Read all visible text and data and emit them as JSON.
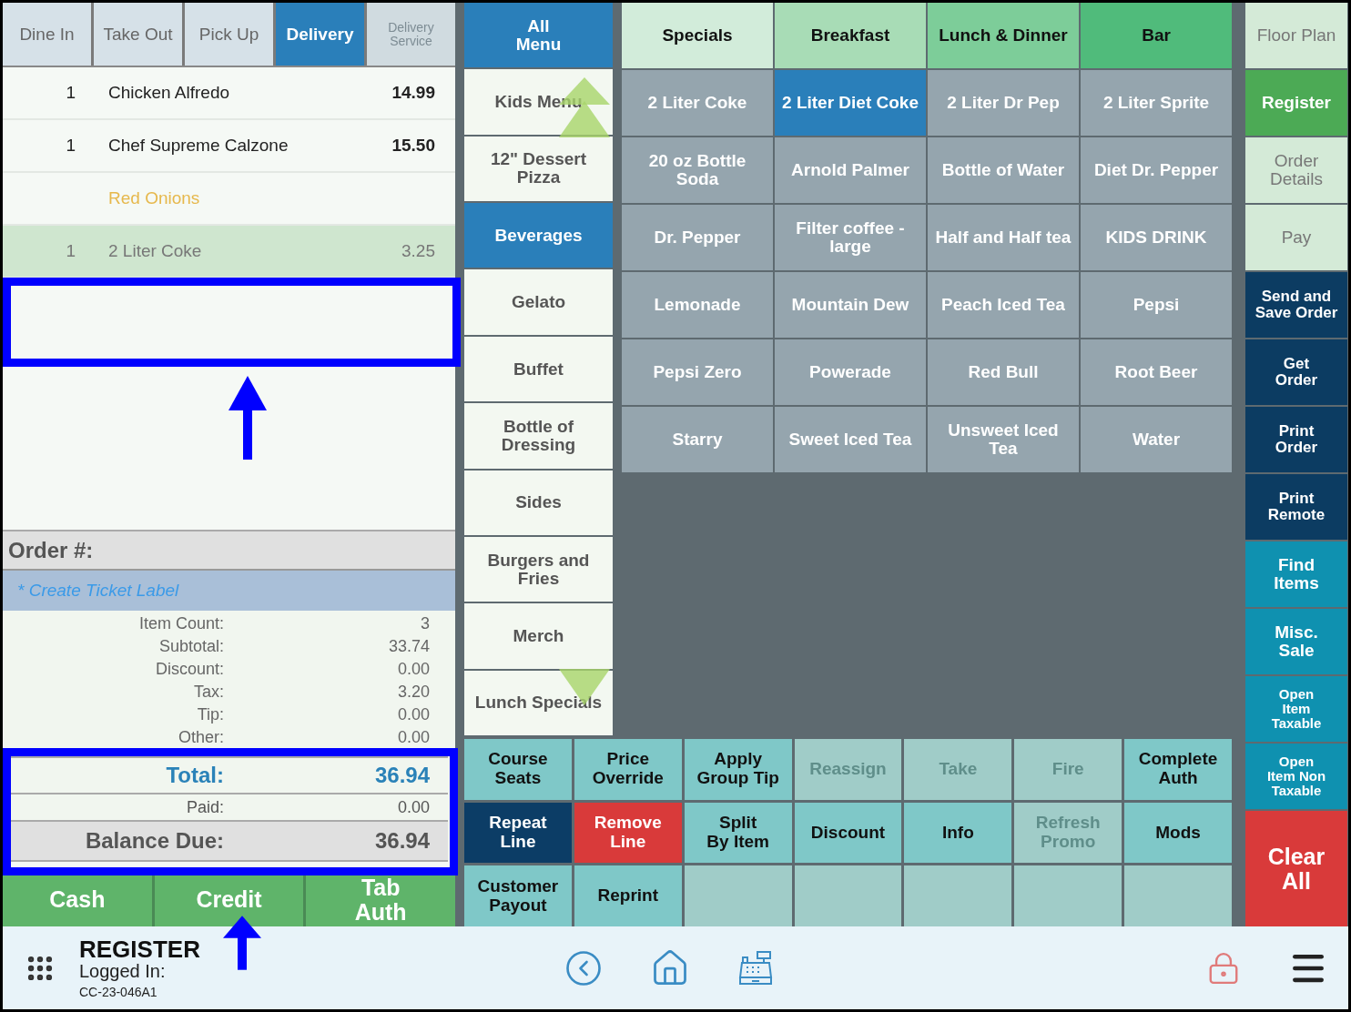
{
  "order_tabs": [
    {
      "label": "Dine In",
      "selected": false,
      "disabled": false
    },
    {
      "label": "Take Out",
      "selected": false,
      "disabled": false
    },
    {
      "label": "Pick Up",
      "selected": false,
      "disabled": false
    },
    {
      "label": "Delivery",
      "selected": true,
      "disabled": false
    },
    {
      "label": "Delivery\nService",
      "selected": false,
      "disabled": true
    }
  ],
  "order_lines": [
    {
      "kind": "item",
      "qty": "1",
      "name": "Chicken Alfredo",
      "price": "14.99",
      "selected": false
    },
    {
      "kind": "item",
      "qty": "1",
      "name": "Chef Supreme Calzone",
      "price": "15.50",
      "selected": false
    },
    {
      "kind": "modifier",
      "name": "Red Onions",
      "selected": false
    },
    {
      "kind": "item",
      "qty": "1",
      "name": "2 Liter Coke",
      "price": "3.25",
      "selected": true
    }
  ],
  "order_number": "Order #:",
  "ticket_label": "* Create Ticket Label",
  "summary": [
    {
      "label": "Item Count:",
      "value": "3"
    },
    {
      "label": "Subtotal:",
      "value": "33.74"
    },
    {
      "label": "Discount:",
      "value": "0.00"
    },
    {
      "label": "Tax:",
      "value": "3.20"
    },
    {
      "label": "Tip:",
      "value": "0.00"
    },
    {
      "label": "Other:",
      "value": "0.00"
    }
  ],
  "totals": [
    {
      "kind": "total",
      "label": "Total:",
      "value": "36.94"
    },
    {
      "kind": "paid",
      "label": "Paid:",
      "value": "0.00"
    },
    {
      "kind": "balance",
      "label": "Balance Due:",
      "value": "36.94"
    }
  ],
  "payment_buttons": [
    "Cash",
    "Credit",
    "Tab\nAuth"
  ],
  "categories": [
    {
      "label": "All\nMenu",
      "selected": true
    },
    {
      "label": "Kids Menu",
      "selected": false
    },
    {
      "label": "12\" Dessert\nPizza",
      "selected": false
    },
    {
      "label": "Beverages",
      "selected": true
    },
    {
      "label": "Gelato",
      "selected": false
    },
    {
      "label": "Buffet",
      "selected": false
    },
    {
      "label": "Bottle of\nDressing",
      "selected": false
    },
    {
      "label": "Sides",
      "selected": false
    },
    {
      "label": "Burgers and\nFries",
      "selected": false
    },
    {
      "label": "Merch",
      "selected": false
    },
    {
      "label": "Lunch Specials",
      "selected": false
    }
  ],
  "menu_tabs": [
    {
      "label": "Specials",
      "color": "#d2ecda"
    },
    {
      "label": "Breakfast",
      "color": "#a8dcb6"
    },
    {
      "label": "Lunch & Dinner",
      "color": "#7dcd99"
    },
    {
      "label": "Bar",
      "color": "#50bb7b"
    }
  ],
  "items": [
    {
      "label": "2 Liter Coke",
      "selected": false
    },
    {
      "label": "2 Liter Diet Coke",
      "selected": true
    },
    {
      "label": "2 Liter Dr Pep",
      "selected": false
    },
    {
      "label": "2 Liter Sprite",
      "selected": false
    },
    {
      "label": "20 oz Bottle\nSoda",
      "selected": false
    },
    {
      "label": "Arnold Palmer",
      "selected": false
    },
    {
      "label": "Bottle of Water",
      "selected": false
    },
    {
      "label": "Diet Dr. Pepper",
      "selected": false
    },
    {
      "label": "Dr. Pepper",
      "selected": false
    },
    {
      "label": "Filter coffee -\nlarge",
      "selected": false
    },
    {
      "label": "Half and Half tea",
      "selected": false
    },
    {
      "label": "KIDS DRINK",
      "selected": false
    },
    {
      "label": "Lemonade",
      "selected": false
    },
    {
      "label": "Mountain Dew",
      "selected": false
    },
    {
      "label": "Peach Iced Tea",
      "selected": false
    },
    {
      "label": "Pepsi",
      "selected": false
    },
    {
      "label": "Pepsi Zero",
      "selected": false
    },
    {
      "label": "Powerade",
      "selected": false
    },
    {
      "label": "Red Bull",
      "selected": false
    },
    {
      "label": "Root Beer",
      "selected": false
    },
    {
      "label": "Starry",
      "selected": false
    },
    {
      "label": "Sweet Iced Tea",
      "selected": false
    },
    {
      "label": "Unsweet Iced Tea",
      "selected": false
    },
    {
      "label": "Water",
      "selected": false
    }
  ],
  "actions": [
    {
      "kind": "normal",
      "label": "Course\nSeats"
    },
    {
      "kind": "normal",
      "label": "Price\nOverride"
    },
    {
      "kind": "normal",
      "label": "Apply\nGroup Tip"
    },
    {
      "kind": "disabled",
      "label": "Reassign"
    },
    {
      "kind": "disabled",
      "label": "Take"
    },
    {
      "kind": "disabled",
      "label": "Fire"
    },
    {
      "kind": "normal",
      "label": "Complete\nAuth"
    },
    {
      "kind": "dark",
      "label": "Repeat\nLine"
    },
    {
      "kind": "danger",
      "label": "Remove\nLine"
    },
    {
      "kind": "normal",
      "label": "Split\nBy Item"
    },
    {
      "kind": "normal",
      "label": "Discount"
    },
    {
      "kind": "normal",
      "label": "Info"
    },
    {
      "kind": "disabled",
      "label": "Refresh\nPromo"
    },
    {
      "kind": "normal",
      "label": "Mods"
    },
    {
      "kind": "normal",
      "label": "Customer\nPayout"
    },
    {
      "kind": "normal",
      "label": "Reprint"
    },
    {
      "kind": "empty"
    },
    {
      "kind": "empty"
    },
    {
      "kind": "empty"
    },
    {
      "kind": "empty"
    },
    {
      "kind": "empty"
    }
  ],
  "side_buttons": [
    {
      "kind": "nav",
      "label": "Floor Plan",
      "selected": false
    },
    {
      "kind": "nav",
      "label": "Register",
      "selected": true
    },
    {
      "kind": "nav",
      "label": "Order\nDetails",
      "selected": false
    },
    {
      "kind": "nav",
      "label": "Pay",
      "selected": false
    },
    {
      "kind": "dark",
      "label": "Send and\nSave Order"
    },
    {
      "kind": "dark",
      "label": "Get\nOrder"
    },
    {
      "kind": "dark",
      "label": "Print\nOrder"
    },
    {
      "kind": "dark",
      "label": "Print\nRemote"
    },
    {
      "kind": "teal",
      "label": "Find\nItems"
    },
    {
      "kind": "teal",
      "label": "Misc.\nSale"
    },
    {
      "kind": "teal_small",
      "label": "Open\nItem\nTaxable"
    },
    {
      "kind": "teal_small",
      "label": "Open\nItem Non\nTaxable"
    },
    {
      "kind": "danger",
      "label": "Clear\nAll"
    }
  ],
  "status_bar": {
    "title": "REGISTER",
    "logged_in": "Logged In:",
    "station": "CC-23-046A1"
  }
}
